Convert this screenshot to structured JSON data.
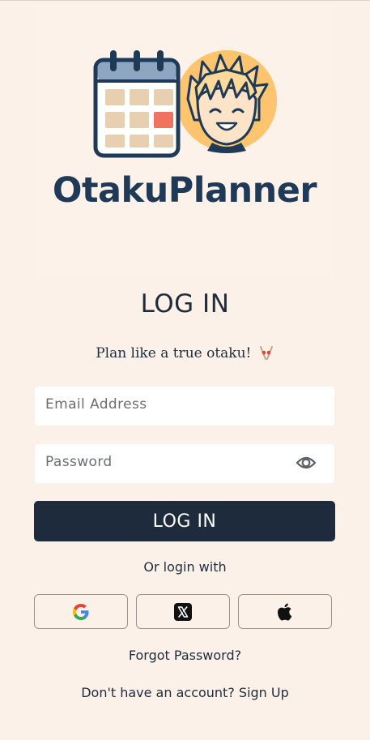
{
  "app": {
    "brand_name": "OtakuPlanner"
  },
  "login": {
    "heading": "LOG IN",
    "tagline": "Plan like a true otaku!",
    "email_placeholder": "Email Address",
    "email_value": "",
    "password_placeholder": "Password",
    "password_value": "",
    "submit_label": "LOG IN",
    "alt_login_text": "Or login with",
    "social_providers": [
      "google-icon",
      "x-icon",
      "apple-icon"
    ],
    "forgot_password": "Forgot Password?",
    "signup_prompt": "Don't have an account?",
    "signup_link": "Sign Up"
  },
  "colors": {
    "background": "#fcf1e8",
    "primary": "#1e2b3c",
    "brand": "#1f3a57",
    "calendar_highlight": "#f0735f",
    "avatar_circle": "#ffc46e"
  }
}
